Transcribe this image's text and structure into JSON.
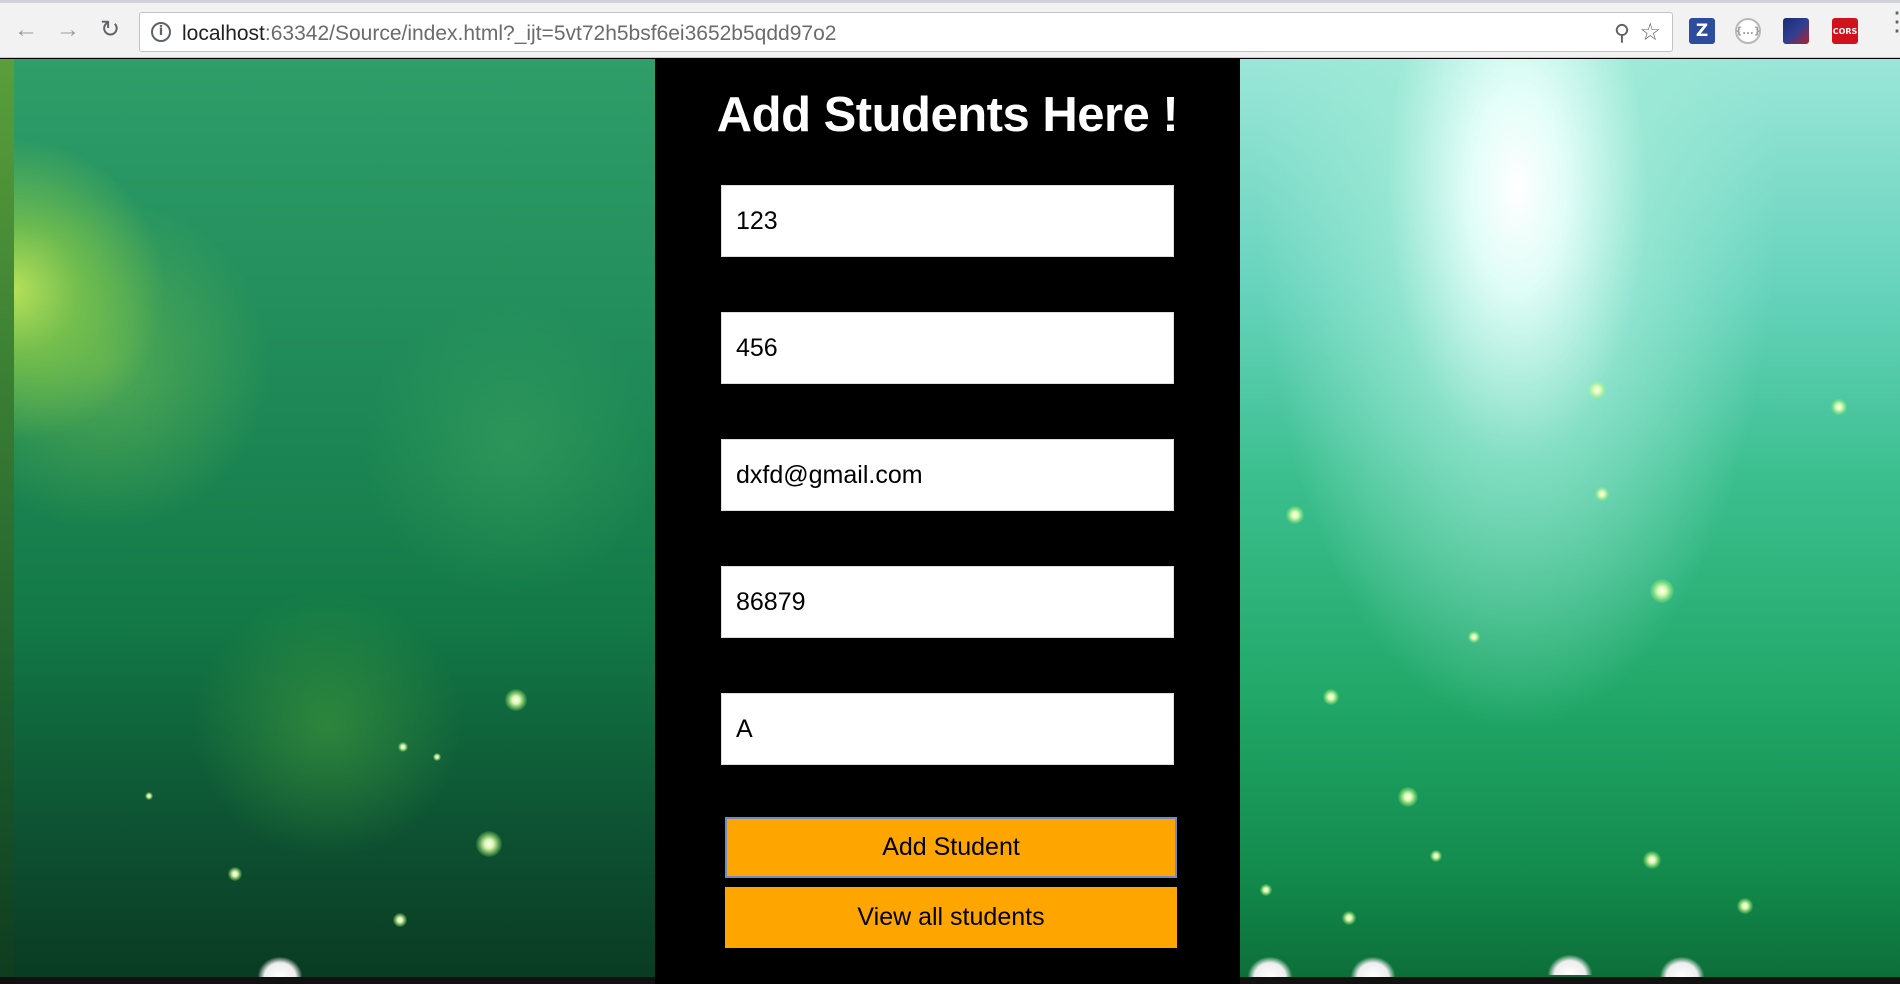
{
  "browser": {
    "url_host": "localhost",
    "url_rest": ":63342/Source/index.html?_ijt=5vt72h5bsf6ei3652b5qdd97o2",
    "back_icon": "back-arrow-icon",
    "forward_icon": "forward-arrow-icon",
    "reload_icon": "reload-icon",
    "info_icon": "info-icon",
    "zoom_icon": "zoom-icon",
    "star_icon": "bookmark-star-icon",
    "extensions": {
      "z_label": "Z",
      "json_label": "{...}",
      "cors_label": "CORS"
    }
  },
  "form": {
    "title": "Add Students Here !",
    "fields": [
      {
        "value": "123"
      },
      {
        "value": "456"
      },
      {
        "value": "dxfd@gmail.com"
      },
      {
        "value": "86879"
      },
      {
        "value": "A"
      }
    ],
    "add_button_label": "Add Student",
    "view_button_label": "View all students"
  },
  "colors": {
    "panel_bg": "#000000",
    "button_bg": "#ffa500",
    "title_color": "#ffffff"
  }
}
